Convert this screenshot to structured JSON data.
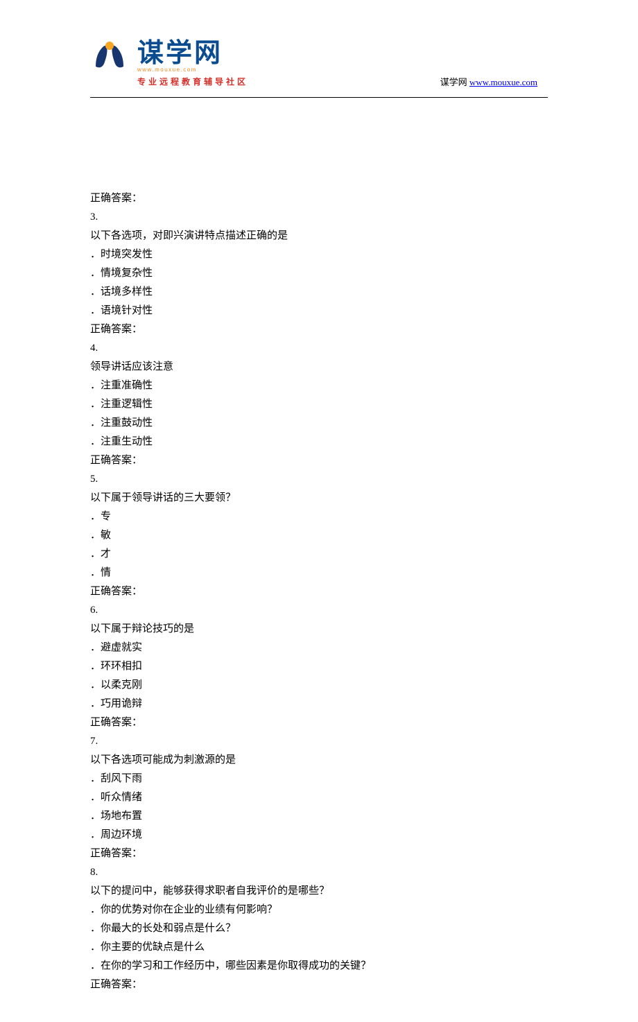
{
  "header": {
    "logo_cn": "谋学网",
    "logo_url_text": "www.mouxue.com",
    "logo_subtitle": "专业远程教育辅导社区",
    "site_label": "谋学网 ",
    "site_link": "www.mouxue.com"
  },
  "questions": [
    {
      "answer_label": "正确答案：",
      "number": "3.",
      "title": "以下各选项，对即兴演讲特点描述正确的是",
      "options": [
        "．时境突发性",
        "．情境复杂性",
        "．话境多样性",
        "．语境针对性"
      ],
      "answer_after": "正确答案："
    },
    {
      "number": "4.",
      "title": "领导讲话应该注意",
      "options": [
        "．注重准确性",
        "．注重逻辑性",
        "．注重鼓动性",
        "．注重生动性"
      ],
      "answer_after": "正确答案："
    },
    {
      "number": "5.",
      "title": "以下属于领导讲话的三大要领？",
      "options": [
        "．专",
        "．敏",
        "．才",
        "．情"
      ],
      "answer_after": "正确答案："
    },
    {
      "number": "6.",
      "title": "以下属于辩论技巧的是",
      "options": [
        "．避虚就实",
        "．环环相扣",
        "．以柔克刚",
        "．巧用诡辩"
      ],
      "answer_after": "正确答案："
    },
    {
      "number": "7.",
      "title": "以下各选项可能成为刺激源的是",
      "options": [
        "．刮风下雨",
        "．听众情绪",
        "．场地布置",
        "．周边环境"
      ],
      "answer_after": "正确答案："
    },
    {
      "number": "8.",
      "title": "以下的提问中，能够获得求职者自我评价的是哪些？",
      "options": [
        "．你的优势对你在企业的业绩有何影响？",
        "．你最大的长处和弱点是什么？",
        "．你主要的优缺点是什么",
        "．在你的学习和工作经历中，哪些因素是你取得成功的关键？"
      ],
      "answer_after": "正确答案："
    }
  ]
}
